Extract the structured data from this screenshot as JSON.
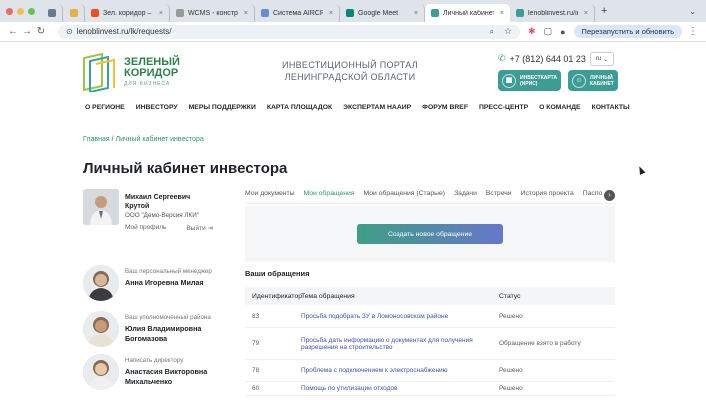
{
  "browser": {
    "tabs": [
      {
        "label": "",
        "fav": "#6b7b8c",
        "small": true
      },
      {
        "label": "",
        "fav": "#e8b04a",
        "small": true
      },
      {
        "label": "Зел. коридор – Fig...",
        "fav": "#f24e1e"
      },
      {
        "label": "WCMS - конструк...",
        "fav": "#999"
      },
      {
        "label": "Система AIRCRM",
        "fav": "#6a8cd6"
      },
      {
        "label": "Google Meet",
        "fav": "#00897b"
      },
      {
        "label": "Личный кабинет...",
        "fav": "#3d9c93",
        "active": true
      },
      {
        "label": "lenoblinvest.ru/inve...",
        "fav": "#3d9c93"
      }
    ],
    "url": "lenoblinvest.ru/lk/requests/",
    "restart_label": "Перезапустить и обновить"
  },
  "header": {
    "logo_line1": "ЗЕЛЕНЫЙ",
    "logo_line2": "КОРИДОР",
    "logo_sub": "ДЛЯ БИЗНЕСА",
    "portal_line1": "ИНВЕСТИЦИОННЫЙ ПОРТАЛ",
    "portal_line2": "ЛЕНИНГРАДСКОЙ ОБЛАСТИ",
    "phone": "+7 (812) 644 01 23",
    "lang": "ru",
    "map_btn_line1": "ИНВЕСТКАРТА",
    "map_btn_line2": "(ИРИС)",
    "cabinet_btn_line1": "ЛИЧНЫЙ",
    "cabinet_btn_line2": "КАБИНЕТ"
  },
  "nav": [
    "О РЕГИОНЕ",
    "ИНВЕСТОРУ",
    "МЕРЫ ПОДДЕРЖКИ",
    "КАРТА ПЛОЩАДОК",
    "ЭКСПЕРТАМ НААИР",
    "ФОРУМ BREF",
    "ПРЕСС-ЦЕНТР",
    "О КОМАНДЕ",
    "КОНТАКТЫ"
  ],
  "breadcrumb": {
    "home": "Главная",
    "sep": "/",
    "current": "Личный кабинет инвестора"
  },
  "page_title": "Личный кабинет инвестора",
  "user": {
    "name": "Михаил Сергеевич Крутой",
    "company": "ООО \"Демо-Версия ЛКИ\"",
    "profile_link": "Мой профиль",
    "logout_link": "Выйти"
  },
  "contacts": [
    {
      "label": "Ваш персональный менеджер",
      "name": "Анна Игоревна Милая"
    },
    {
      "label": "Ваш уполномоченный района",
      "name": "Юлия Владимировна Богомазова"
    },
    {
      "label": "Написать директору",
      "name": "Анастасия Викторовна Михальченко"
    }
  ],
  "tabs": [
    "Мои документы",
    "Мои обращения",
    "Мои обращения (Старые)",
    "Задачи",
    "Встречи",
    "История проекта",
    "Паспо"
  ],
  "active_tab": "Мои обращения",
  "create_button": "Создать новое обращение",
  "requests": {
    "section_title": "Ваши обращения",
    "columns": [
      "Идентификатор",
      "Тема обращения",
      "Статус"
    ],
    "rows": [
      {
        "id": "83",
        "topic": "Просьба подобрать ЗУ в Ломоносовском районе",
        "status": "Решено"
      },
      {
        "id": "79",
        "topic": "Просьба дать информацию о документах для получения разрешения на строительство",
        "status": "Обращение взято в работу"
      },
      {
        "id": "78",
        "topic": "Проблема с подключением к электроснабжению",
        "status": "Решено"
      },
      {
        "id": "60",
        "topic": "Помощь по утилизации отходов",
        "status": "Решено"
      }
    ]
  }
}
